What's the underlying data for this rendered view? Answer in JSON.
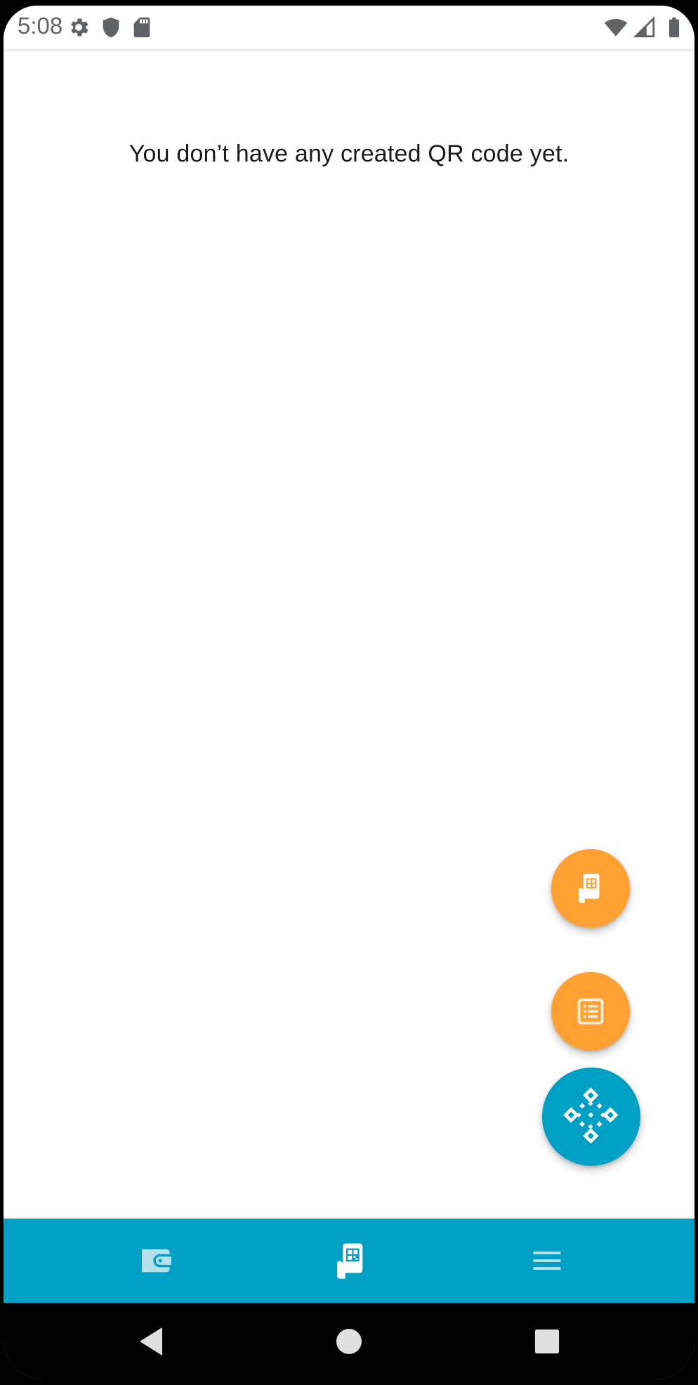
{
  "status_bar": {
    "time": "5:08",
    "left_icons": [
      "gear-icon",
      "shield-icon",
      "sd-card-icon"
    ],
    "right_icons": [
      "wifi-icon",
      "signal-icon",
      "battery-icon"
    ]
  },
  "main": {
    "empty_message": "You don’t have any created QR code yet."
  },
  "fabs": [
    {
      "name": "scan-qr-fab",
      "icon": "phone-qr-icon",
      "color": "#ffa033"
    },
    {
      "name": "list-fab",
      "icon": "list-icon",
      "color": "#ffa033"
    },
    {
      "name": "create-qr-fab",
      "icon": "qr-code-icon",
      "color": "#00a0c4"
    }
  ],
  "bottom_nav": {
    "background": "#00a0c4",
    "items": [
      {
        "name": "wallet",
        "icon": "wallet-icon",
        "active": false
      },
      {
        "name": "qr-codes",
        "icon": "phone-qr-icon",
        "active": true
      },
      {
        "name": "menu",
        "icon": "menu-icon",
        "active": false
      }
    ]
  },
  "system_nav": [
    "back-icon",
    "home-icon",
    "recents-icon"
  ]
}
